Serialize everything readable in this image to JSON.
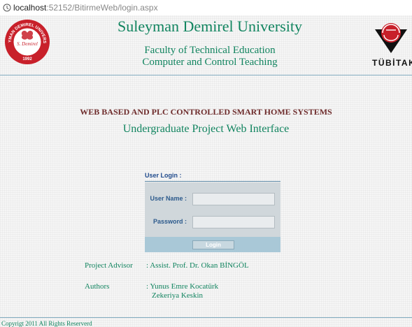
{
  "browser": {
    "url_host": "localhost",
    "url_path": ":52152/BitirmeWeb/login.aspx"
  },
  "header": {
    "university": "Suleyman Demirel University",
    "faculty": "Faculty of Technical Education",
    "department": "Computer and Control Teaching",
    "left_logo_text_top": "SULEYMAN DEMIREL UNIVERSITESI",
    "left_logo_year": "1992",
    "left_logo_signature": "S. Demirel",
    "right_logo_text": "TÜBİTAK"
  },
  "project": {
    "title": "WEB BASED AND PLC CONTROLLED SMART HOME SYSTEMS",
    "subtitle": "Undergraduate Project Web Interface"
  },
  "login": {
    "section_label": "User Login :",
    "username_label": "User Name :",
    "username_value": "",
    "password_label": "Password :",
    "password_value": "",
    "button_label": "Login"
  },
  "info": {
    "advisor_label": "Project Advisor",
    "advisor_value": ": Assist. Prof. Dr. Okan BİNGÖL",
    "authors_label": "Authors",
    "author_1": ": Yunus Emre Kocatürk",
    "author_2": "Zekeriya Keskin"
  },
  "footer": {
    "copyright": "Copyrigt 2011 All Rights Reserverd"
  },
  "colors": {
    "accent_green": "#11845f",
    "title_maroon": "#6e2c2c",
    "login_blue": "#1f4a8c",
    "logo_red": "#c8202a"
  }
}
